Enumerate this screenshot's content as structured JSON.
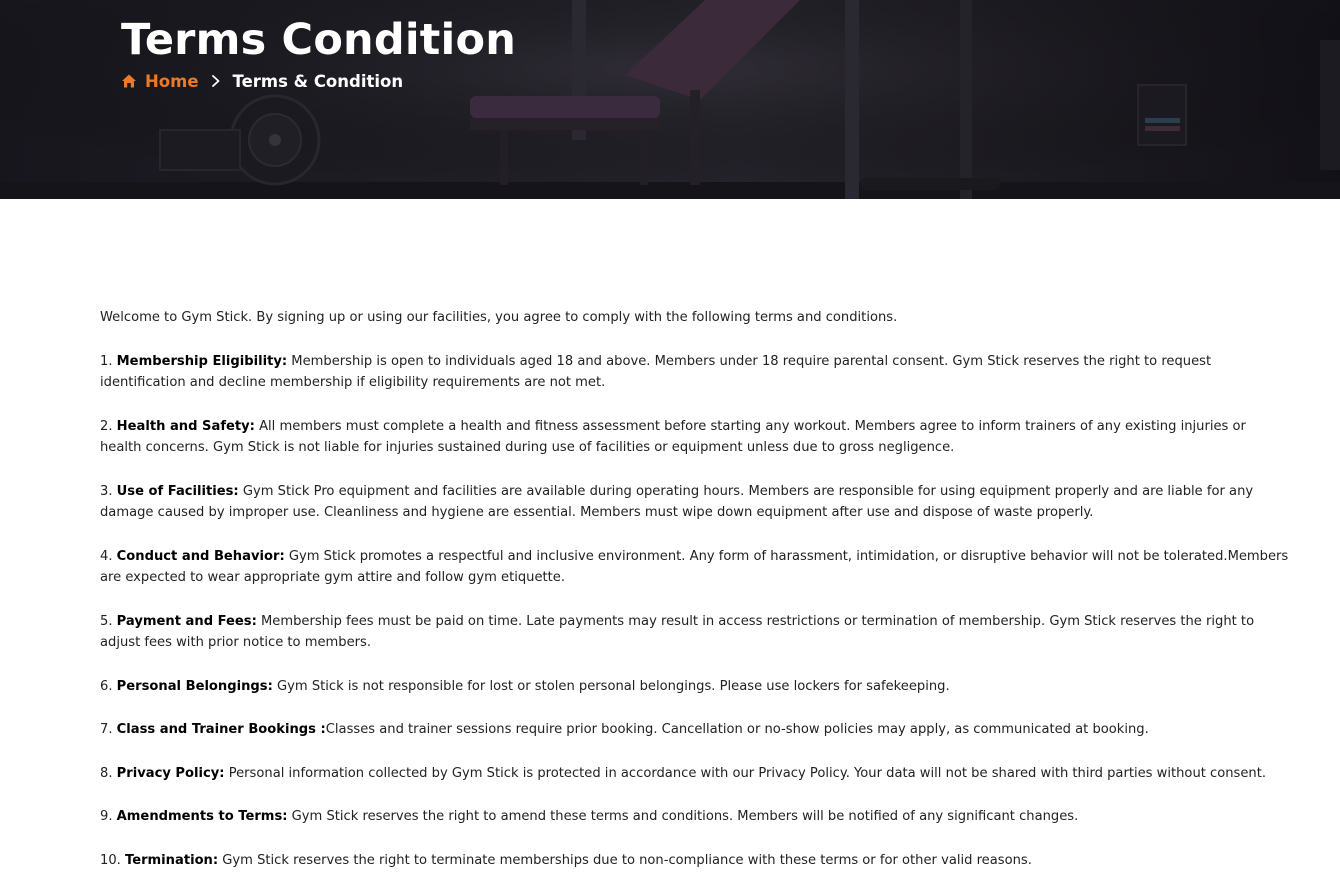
{
  "hero": {
    "title": "Terms Condition",
    "breadcrumb": {
      "home_icon": "home-icon",
      "home_label": "Home",
      "separator_icon": "chevron-right-icon",
      "current_label": "Terms & Condition"
    },
    "colors": {
      "accent": "#ec7a25",
      "title": "#ffffff",
      "background": "#1e1d24"
    }
  },
  "content": {
    "intro": "Welcome to Gym Stick. By signing up or using our facilities, you agree to comply with the following terms and conditions.",
    "terms": [
      {
        "number": "1. ",
        "heading": "Membership Eligibility:",
        "text": " Membership is open to individuals aged 18 and above. Members under 18 require parental consent. Gym Stick  reserves the right to request identification and decline membership if eligibility requirements are not met."
      },
      {
        "number": "2. ",
        "heading": "Health and Safety:",
        "text": " All members must complete a health and fitness assessment before starting any workout. Members agree to inform trainers of any existing injuries or health concerns. Gym Stick  is not liable for injuries sustained during use of facilities or equipment unless due to gross negligence."
      },
      {
        "number": "3. ",
        "heading": "Use of Facilities:",
        "text": " Gym Stick Pro equipment and facilities are available during operating hours. Members are responsible for using equipment properly and are liable for any damage caused by improper use. Cleanliness and hygiene are essential. Members must wipe down equipment after use and dispose of waste properly."
      },
      {
        "number": "4. ",
        "heading": "Conduct and Behavior:",
        "text": " Gym Stick promotes a respectful and inclusive environment. Any form of harassment, intimidation, or disruptive behavior will not be tolerated.Members are expected to wear appropriate gym attire and follow gym etiquette."
      },
      {
        "number": "5. ",
        "heading": "Payment and Fees:",
        "text": " Membership fees must be paid on time. Late payments may result in access restrictions or termination of membership. Gym Stick reserves the right to adjust fees with prior notice to members."
      },
      {
        "number": "6. ",
        "heading": "Personal Belongings:",
        "text": " Gym Stick is not responsible for lost or stolen personal belongings. Please use lockers for safekeeping."
      },
      {
        "number": "7. ",
        "heading": "Class and Trainer Bookings :",
        "text": "Classes and trainer sessions require prior booking. Cancellation or no-show policies may apply, as communicated at booking."
      },
      {
        "number": "8. ",
        "heading": "Privacy Policy:",
        "text": " Personal information collected by Gym Stick is protected in accordance with our Privacy Policy. Your data will not be shared with third parties without consent."
      },
      {
        "number": "9. ",
        "heading": "Amendments to Terms:",
        "text": " Gym Stick reserves the right to amend these terms and conditions. Members will be notified of any significant changes."
      },
      {
        "number": "10. ",
        "heading": "Termination:",
        "text": " Gym Stick reserves the right to terminate memberships due to non-compliance with these terms or for other valid reasons."
      }
    ]
  }
}
